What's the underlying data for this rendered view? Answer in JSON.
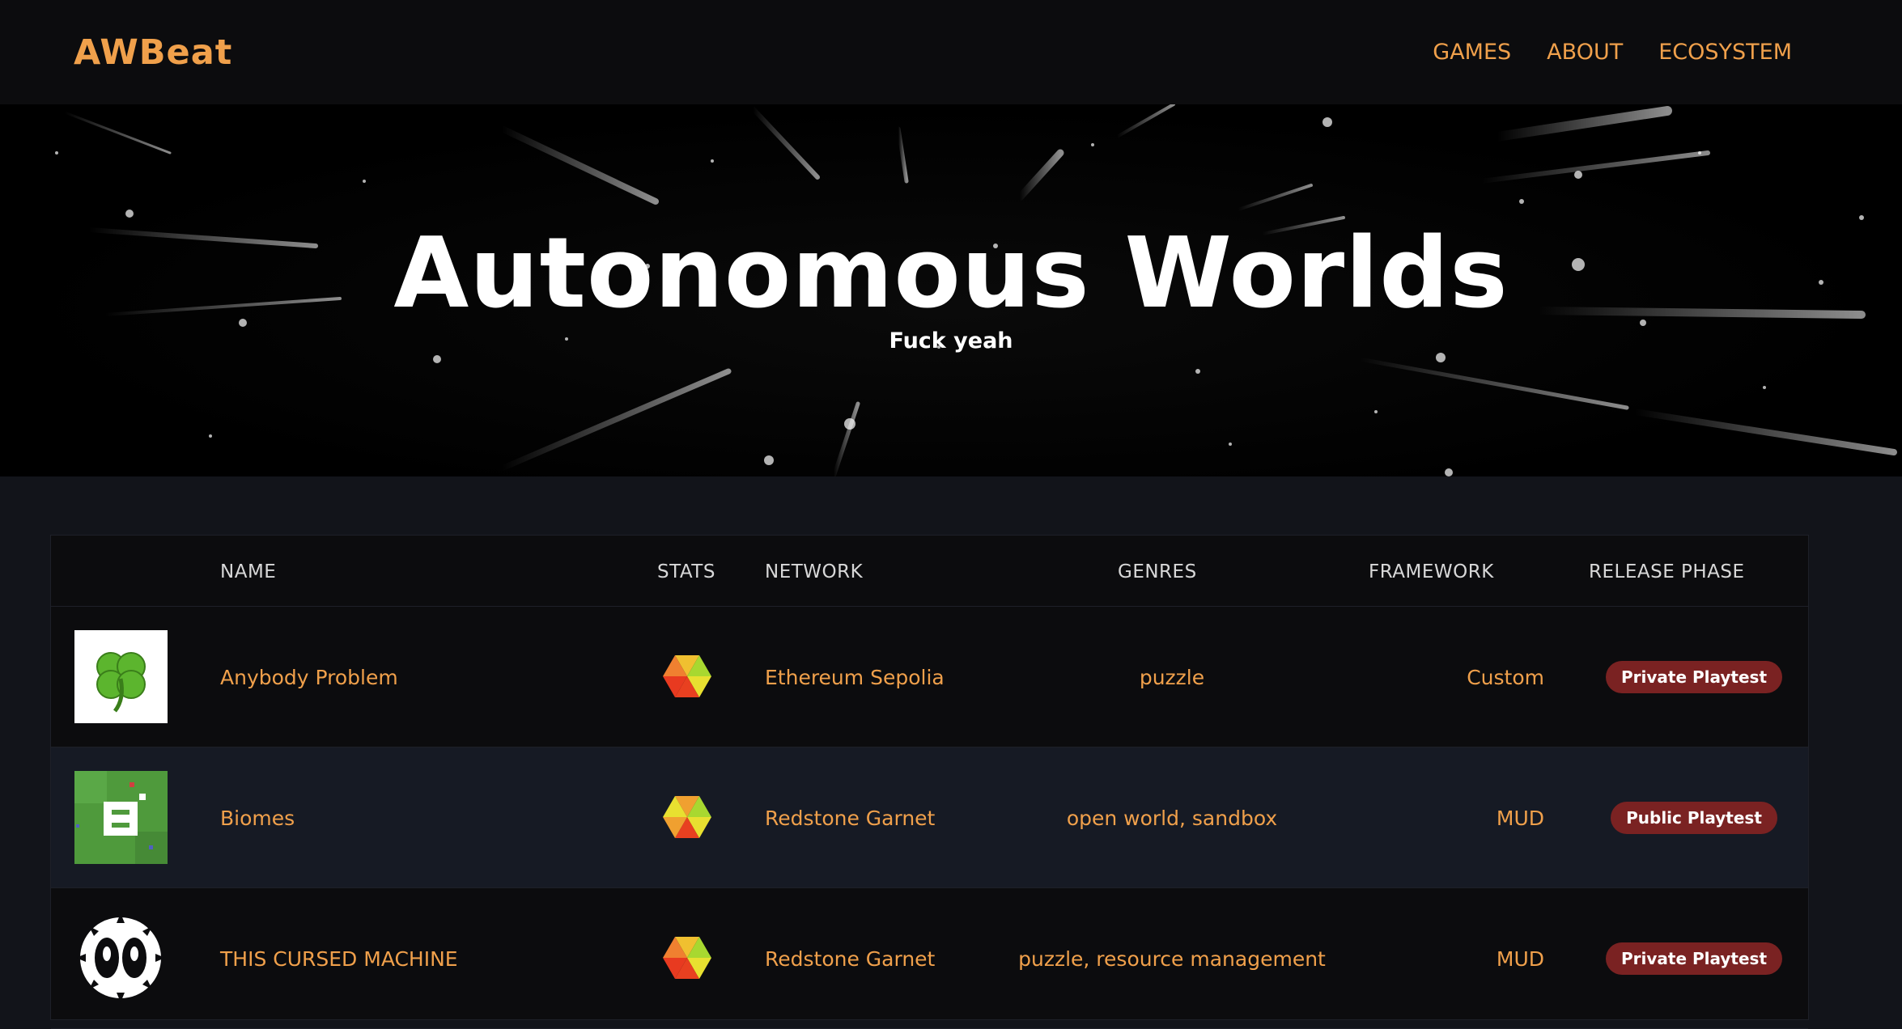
{
  "header": {
    "logo": "AWBeat",
    "nav": [
      "GAMES",
      "ABOUT",
      "ECOSYSTEM"
    ]
  },
  "hero": {
    "title": "Autonomous Worlds",
    "subtitle": "Fuck yeah"
  },
  "table": {
    "columns": [
      "NAME",
      "STATS",
      "NETWORK",
      "GENRES",
      "FRAMEWORK",
      "RELEASE PHASE"
    ],
    "rows": [
      {
        "name": "Anybody Problem",
        "network": "Ethereum Sepolia",
        "genres": "puzzle",
        "framework": "Custom",
        "phase": "Private Playtest",
        "icon": "clover-icon"
      },
      {
        "name": "Biomes",
        "network": "Redstone Garnet",
        "genres": "open world, sandbox",
        "framework": "MUD",
        "phase": "Public Playtest",
        "icon": "biomes-logo-icon"
      },
      {
        "name": "THIS CURSED MACHINE",
        "network": "Redstone Garnet",
        "genres": "puzzle, resource management",
        "framework": "MUD",
        "phase": "Private Playtest",
        "icon": "cursed-machine-logo-icon"
      }
    ]
  },
  "colors": {
    "accent": "#f0a04b",
    "badge": "#7a2222",
    "background": "#12141a",
    "row_alt": "#161a24"
  }
}
